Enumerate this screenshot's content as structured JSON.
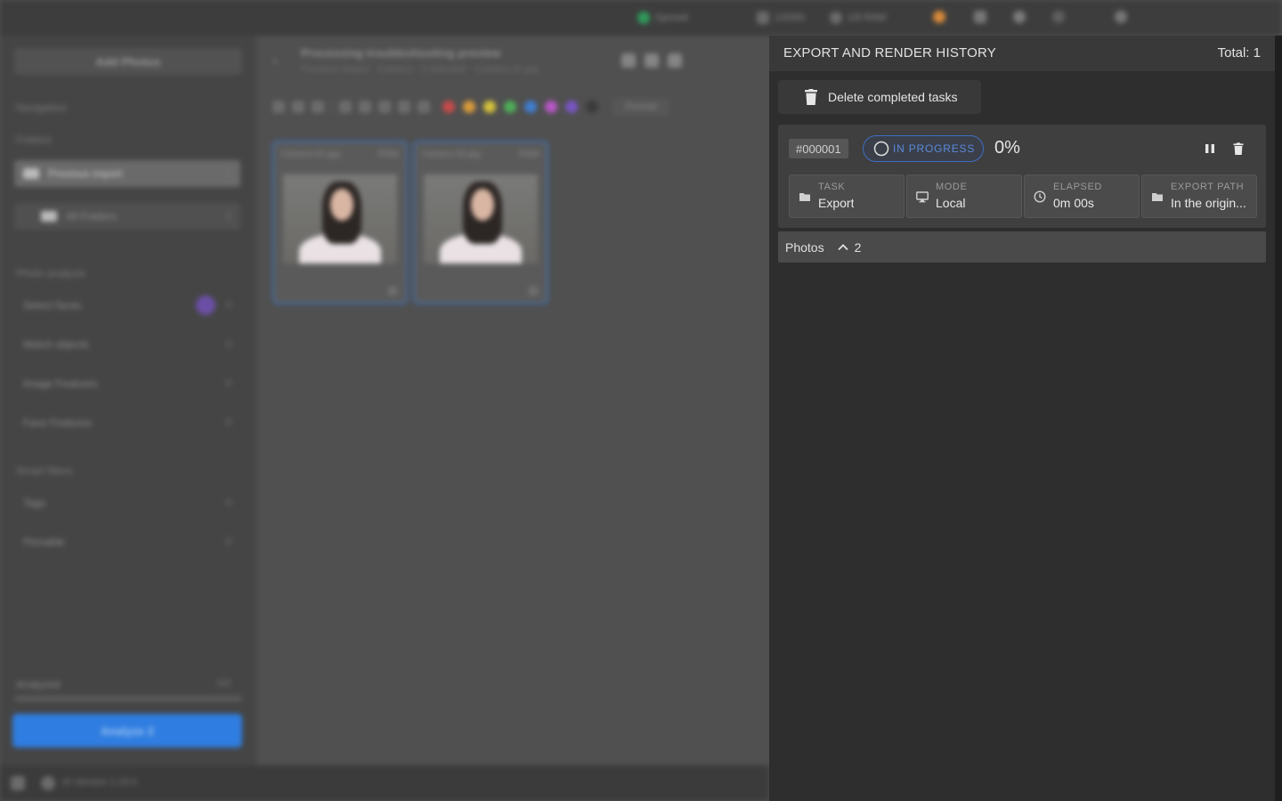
{
  "background_app": {
    "topbar": {
      "status_label": "Synced",
      "counter_1": "1/2000",
      "counter_2": "1/6 RAW"
    },
    "sidebar": {
      "import_button": "Add Photos",
      "navigation_header": "Navigation",
      "folders_header": "Folders",
      "items": [
        {
          "label": "Previous import",
          "count": "2"
        },
        {
          "label": "All Folders",
          "count": "2"
        }
      ],
      "photo_analysis_header": "Photo analysis",
      "analysis_items": [
        {
          "label": "Select faces",
          "count": "0"
        },
        {
          "label": "Match objects",
          "count": "0"
        },
        {
          "label": "Image Features",
          "count": "0"
        },
        {
          "label": "Face Features",
          "count": "0"
        }
      ],
      "smart_filters_header": "Smart filters",
      "filter_items": [
        {
          "label": "Tags",
          "count": "0"
        },
        {
          "label": "Pinnable",
          "count": "0"
        }
      ],
      "progress_label": "Analyzed",
      "progress_count": "0/2",
      "analyze_button": "Analyze 2"
    },
    "main": {
      "title": "Processing troubleshooting preview",
      "subtitle": "Previous import · Camera · 2 selected · Camera 01.jpg",
      "format_label": "Format",
      "photos": [
        {
          "name": "Camera 01.jpg",
          "tag": "RAW"
        },
        {
          "name": "Camera 02.jpg",
          "tag": "RAW"
        }
      ]
    },
    "statusbar": {
      "version": "AI Version 1.19.0"
    },
    "colors": {
      "accent": "#2f7de0",
      "labels": [
        "#c94a4a",
        "#d99b3a",
        "#d6c23c",
        "#4fae58",
        "#3f7ed0",
        "#b957c9",
        "#7a55c7",
        "#3a3a3a"
      ]
    }
  },
  "history_panel": {
    "title": "EXPORT AND RENDER HISTORY",
    "total": "Total: 1",
    "delete_completed_label": "Delete completed tasks",
    "task": {
      "id": "#000001",
      "status": "IN PROGRESS",
      "percent": "0%",
      "status_color": "#3d6fc2",
      "tiles": [
        {
          "label": "TASK",
          "value": "Export",
          "icon": "folder-icon"
        },
        {
          "label": "MODE",
          "value": "Local",
          "icon": "monitor-icon"
        },
        {
          "label": "ELAPSED",
          "value": "0m 00s",
          "icon": "clock-icon"
        },
        {
          "label": "EXPORT PATH",
          "value": "In the origin...",
          "icon": "folder-icon"
        }
      ]
    },
    "photos_label": "Photos",
    "photos_count": "2"
  }
}
